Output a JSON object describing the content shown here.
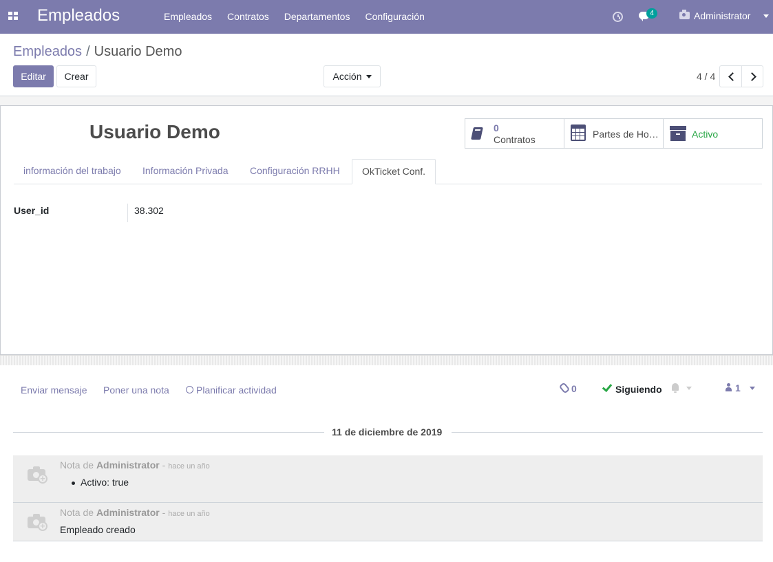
{
  "navbar": {
    "app_title": "Empleados",
    "menu": [
      "Empleados",
      "Contratos",
      "Departamentos",
      "Configuración"
    ],
    "messages_badge": "4",
    "user_name": "Administrator",
    "color": "#7c7bad"
  },
  "breadcrumb": {
    "parent": "Empleados",
    "separator": "/",
    "current": "Usuario Demo"
  },
  "toolbar": {
    "edit_label": "Editar",
    "create_label": "Crear",
    "action_label": "Acción"
  },
  "pager": {
    "value": "4 / 4"
  },
  "employee": {
    "name": "Usuario Demo"
  },
  "smart_buttons": {
    "contracts_count": "0",
    "contracts_label": "Contratos",
    "timesheets_label": "Partes de Ho…",
    "active_label": "Activo"
  },
  "tabs": [
    "información del trabajo",
    "Información Privada",
    "Configuración RRHH",
    "OkTicket Conf."
  ],
  "active_tab": "OkTicket Conf.",
  "fields": {
    "user_id_label": "User_id",
    "user_id_value": "38.302"
  },
  "chatter": {
    "send_message": "Enviar mensaje",
    "log_note": "Poner una nota",
    "schedule_activity": "Planificar actividad",
    "attachments_count": "0",
    "following_label": "Siguiendo",
    "followers_count": "1",
    "date_separator": "11 de diciembre de 2019",
    "messages": [
      {
        "prefix": "Nota de",
        "author": "Administrator",
        "dash": "-",
        "when": "hace un año",
        "bullet": "Activo: true"
      },
      {
        "prefix": "Nota de",
        "author": "Administrator",
        "dash": "-",
        "when": "hace un año",
        "body": "Empleado creado"
      }
    ]
  }
}
